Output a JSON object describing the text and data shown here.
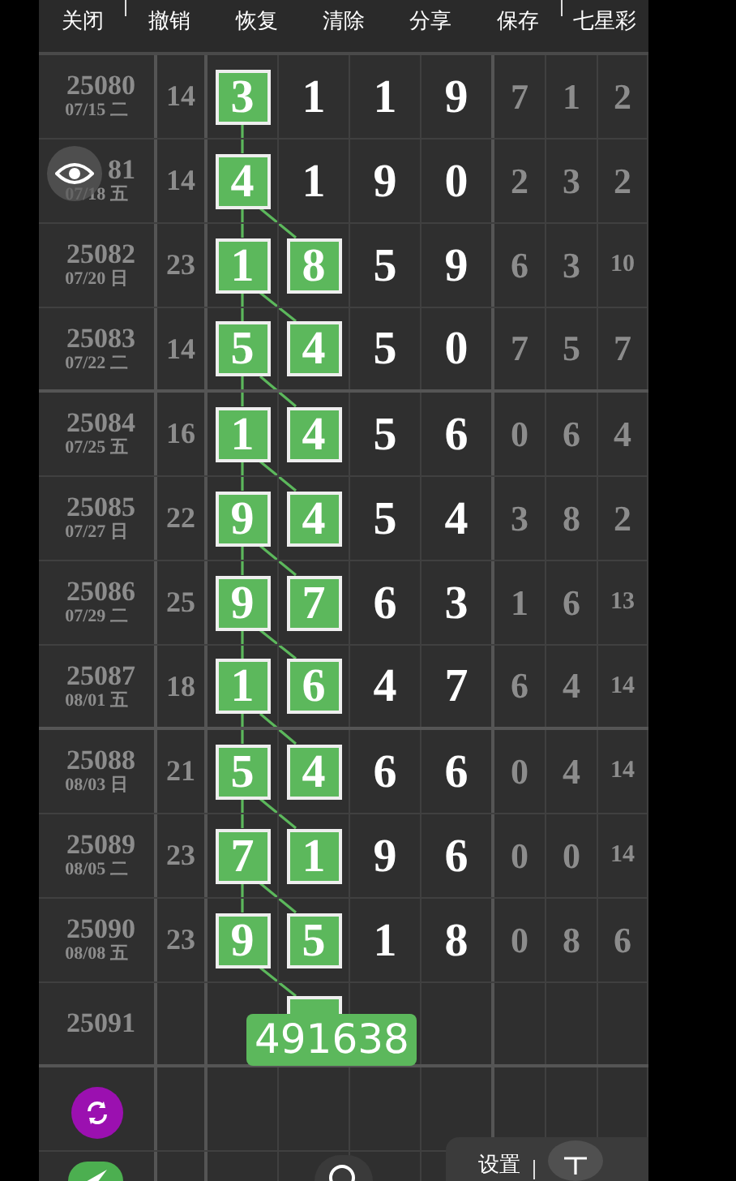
{
  "toolbar": [
    {
      "label": "关闭"
    },
    {
      "label": "撤销"
    },
    {
      "label": "恢复"
    },
    {
      "label": "清除"
    },
    {
      "label": "分享"
    },
    {
      "label": "保存"
    },
    {
      "label": "七星彩"
    }
  ],
  "rows": [
    {
      "issue": "25080",
      "date": "07/15 二",
      "sum": "14",
      "cells": [
        {
          "digit": "3",
          "hit": true
        },
        {
          "digit": "1",
          "hit": false
        },
        {
          "digit": "1",
          "hit": false
        },
        {
          "digit": "9",
          "hit": false
        }
      ],
      "tail": [
        "7",
        "1",
        "2"
      ]
    },
    {
      "issue": "81",
      "date": "07/18 五",
      "sum": "14",
      "cells": [
        {
          "digit": "4",
          "hit": true
        },
        {
          "digit": "1",
          "hit": false
        },
        {
          "digit": "9",
          "hit": false
        },
        {
          "digit": "0",
          "hit": false
        }
      ],
      "tail": [
        "2",
        "3",
        "2"
      ]
    },
    {
      "issue": "25082",
      "date": "07/20 日",
      "sum": "23",
      "cells": [
        {
          "digit": "1",
          "hit": true
        },
        {
          "digit": "8",
          "hit": true
        },
        {
          "digit": "5",
          "hit": false
        },
        {
          "digit": "9",
          "hit": false
        }
      ],
      "tail": [
        "6",
        "3",
        "10"
      ]
    },
    {
      "issue": "25083",
      "date": "07/22 二",
      "sum": "14",
      "cells": [
        {
          "digit": "5",
          "hit": true
        },
        {
          "digit": "4",
          "hit": true
        },
        {
          "digit": "5",
          "hit": false
        },
        {
          "digit": "0",
          "hit": false
        }
      ],
      "tail": [
        "7",
        "5",
        "7"
      ]
    },
    {
      "issue": "25084",
      "date": "07/25 五",
      "sum": "16",
      "cells": [
        {
          "digit": "1",
          "hit": true
        },
        {
          "digit": "4",
          "hit": true
        },
        {
          "digit": "5",
          "hit": false
        },
        {
          "digit": "6",
          "hit": false
        }
      ],
      "tail": [
        "0",
        "6",
        "4"
      ]
    },
    {
      "issue": "25085",
      "date": "07/27 日",
      "sum": "22",
      "cells": [
        {
          "digit": "9",
          "hit": true
        },
        {
          "digit": "4",
          "hit": true
        },
        {
          "digit": "5",
          "hit": false
        },
        {
          "digit": "4",
          "hit": false
        }
      ],
      "tail": [
        "3",
        "8",
        "2"
      ]
    },
    {
      "issue": "25086",
      "date": "07/29 二",
      "sum": "25",
      "cells": [
        {
          "digit": "9",
          "hit": true
        },
        {
          "digit": "7",
          "hit": true
        },
        {
          "digit": "6",
          "hit": false
        },
        {
          "digit": "3",
          "hit": false
        }
      ],
      "tail": [
        "1",
        "6",
        "13"
      ]
    },
    {
      "issue": "25087",
      "date": "08/01 五",
      "sum": "18",
      "cells": [
        {
          "digit": "1",
          "hit": true
        },
        {
          "digit": "6",
          "hit": true
        },
        {
          "digit": "4",
          "hit": false
        },
        {
          "digit": "7",
          "hit": false
        }
      ],
      "tail": [
        "6",
        "4",
        "14"
      ]
    },
    {
      "issue": "25088",
      "date": "08/03 日",
      "sum": "21",
      "cells": [
        {
          "digit": "5",
          "hit": true
        },
        {
          "digit": "4",
          "hit": true
        },
        {
          "digit": "6",
          "hit": false
        },
        {
          "digit": "6",
          "hit": false
        }
      ],
      "tail": [
        "0",
        "4",
        "14"
      ]
    },
    {
      "issue": "25089",
      "date": "08/05 二",
      "sum": "23",
      "cells": [
        {
          "digit": "7",
          "hit": true
        },
        {
          "digit": "1",
          "hit": true
        },
        {
          "digit": "9",
          "hit": false
        },
        {
          "digit": "6",
          "hit": false
        }
      ],
      "tail": [
        "0",
        "0",
        "14"
      ]
    },
    {
      "issue": "25090",
      "date": "08/08 五",
      "sum": "23",
      "cells": [
        {
          "digit": "9",
          "hit": true
        },
        {
          "digit": "5",
          "hit": true
        },
        {
          "digit": "1",
          "hit": false
        },
        {
          "digit": "8",
          "hit": false
        }
      ],
      "tail": [
        "0",
        "8",
        "6"
      ]
    },
    {
      "issue": "25091",
      "cells": [
        {
          "hit": false
        },
        {
          "hit": true
        },
        {
          "hit": false
        },
        {
          "hit": false
        }
      ],
      "prediction": "491638"
    }
  ],
  "settings_panel": {
    "label": "设置"
  }
}
